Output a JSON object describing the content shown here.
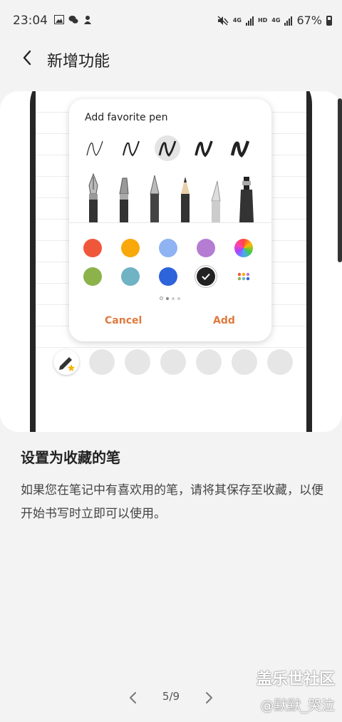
{
  "status_bar": {
    "time": "23:04",
    "battery": "67%",
    "net1": "4G",
    "net2": "HD",
    "net3": "4G"
  },
  "header": {
    "title": "新增功能"
  },
  "illustration": {
    "popup_title": "Add favorite pen",
    "cancel_label": "Cancel",
    "add_label": "Add",
    "colors": [
      "#f0573a",
      "#f9a80a",
      "#8fb3f3",
      "#b57cd3",
      "rainbow",
      "#8cb24a",
      "#6fb3c4",
      "#2d63db",
      "#222222",
      "more"
    ],
    "accent": "#e07a3e"
  },
  "section": {
    "title": "设置为收藏的笔",
    "description": "如果您在笔记中有喜欢用的笔，请将其保存至收藏，以便开始书写时立即可以使用。"
  },
  "pager": {
    "label": "5/9"
  },
  "watermark": {
    "line1": "盖乐世社区",
    "line2": "@默默_哭泣"
  }
}
